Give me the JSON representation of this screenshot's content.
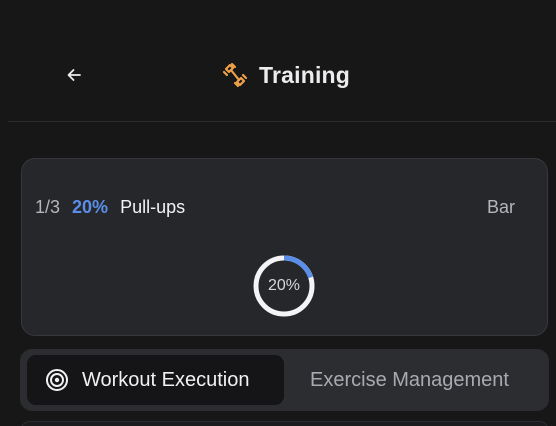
{
  "header": {
    "title": "Training",
    "back_icon": "arrow-left-icon",
    "logo_icon": "dumbbell-icon",
    "accent": "#f0a14a"
  },
  "exercise": {
    "counter": "1/3",
    "progress_text": "20%",
    "progress_fraction": 0.2,
    "name": "Pull-ups",
    "equipment": "Bar",
    "ring_label": "20%",
    "progress_color": "#5b8ee8"
  },
  "tabs": [
    {
      "label": "Workout Execution",
      "icon": "target-icon",
      "active": true
    },
    {
      "label": "Exercise Management",
      "active": false
    }
  ]
}
